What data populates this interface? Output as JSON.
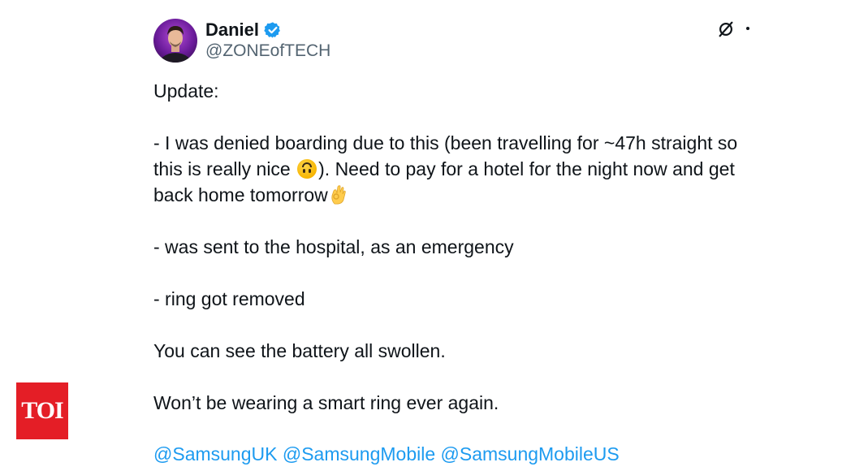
{
  "author": {
    "name": "Daniel",
    "handle": "@ZONEofTECH",
    "verified": true,
    "verified_color": "#1d9bf0"
  },
  "header_icons": {
    "grok": "grok-icon",
    "more": "more-dot-icon"
  },
  "tweet": {
    "line1": "Update:",
    "line2": "- I was denied boarding due to this (been travelling for ~47h straight so",
    "line3_before_emoji": "this is really nice ",
    "line3_emoji": "upside-down-face-emoji",
    "line3_after_emoji": "). Need to pay for a hotel for the night now and get",
    "line4_text": "back home tomorrow",
    "line4_emoji": "ok-hand-emoji",
    "line5": "- was sent to the hospital, as an emergency",
    "line6": "- ring got removed",
    "line7": "You can see the battery all swollen.",
    "line8": "Won’t be wearing a smart ring ever again.",
    "mentions": "@SamsungUK @SamsungMobile @SamsungMobileUS"
  },
  "watermark": {
    "text": "TOI",
    "color": "#e41e26"
  },
  "colors": {
    "text": "#0f1419",
    "secondary": "#536471",
    "link": "#1d9bf0"
  }
}
